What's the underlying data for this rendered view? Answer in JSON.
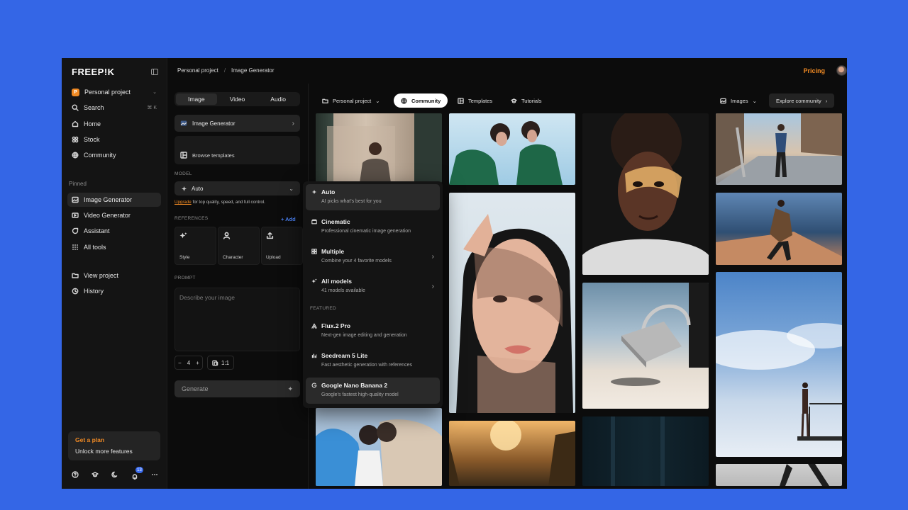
{
  "brand": {
    "logo": "FREEP!K"
  },
  "sidebar": {
    "project": {
      "badge": "P",
      "name": "Personal project"
    },
    "search": {
      "label": "Search",
      "shortcut": "⌘ K"
    },
    "items": [
      {
        "label": "Home"
      },
      {
        "label": "Stock"
      },
      {
        "label": "Community"
      }
    ],
    "pinned_label": "Pinned",
    "pinned": [
      {
        "label": "Image Generator"
      },
      {
        "label": "Video Generator"
      },
      {
        "label": "Assistant"
      },
      {
        "label": "All tools"
      }
    ],
    "extra": [
      {
        "label": "View project"
      },
      {
        "label": "History"
      }
    ],
    "plan": {
      "title": "Get a plan",
      "subtitle": "Unlock more features"
    },
    "notifications": "13"
  },
  "topbar": {
    "crumb_project": "Personal project",
    "crumb_sep": "/",
    "crumb_page": "Image Generator",
    "pricing": "Pricing"
  },
  "generator": {
    "tabs": [
      "Image",
      "Video",
      "Audio"
    ],
    "tool": "Image Generator",
    "browse": "Browse templates",
    "model_label": "MODEL",
    "model_value": "Auto",
    "upgrade_link": "Upgrade",
    "upgrade_text": " for top quality, speed, and full control.",
    "references_label": "REFERENCES",
    "add_label": "+ Add",
    "refs": [
      "Style",
      "Character",
      "Upload"
    ],
    "prompt_label": "PROMPT",
    "prompt_placeholder": "Describe your image",
    "count": "4",
    "ratio": "1:1",
    "generate": "Generate"
  },
  "gallery_bar": {
    "project": "Personal project",
    "community": "Community",
    "templates": "Templates",
    "tutorials": "Tutorials",
    "images": "Images",
    "explore": "Explore community"
  },
  "model_menu": {
    "items": [
      {
        "title": "Auto",
        "subtitle": "AI picks what's best for you"
      },
      {
        "title": "Cinematic",
        "subtitle": "Professional cinematic image generation"
      },
      {
        "title": "Multiple",
        "subtitle": "Combine your 4 favorite models"
      },
      {
        "title": "All models",
        "subtitle": "41 models available"
      }
    ],
    "featured_label": "FEATURED",
    "featured": [
      {
        "title": "Flux.2 Pro",
        "subtitle": "Next-gen image editing and generation"
      },
      {
        "title": "Seedream 5 Lite",
        "subtitle": "Fast aesthetic generation with references"
      },
      {
        "title": "Google Nano Banana 2",
        "subtitle": "Google's fastest high-quality model"
      }
    ]
  },
  "colors": {
    "accent": "#f08a24",
    "background": "#3466e6",
    "link": "#4b82f5"
  }
}
